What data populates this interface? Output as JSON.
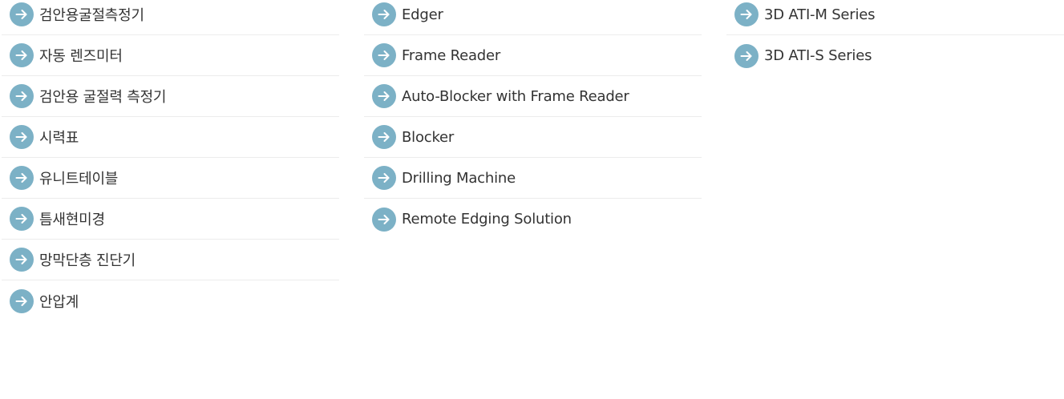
{
  "colors": {
    "icon_background": "#7cb1c6",
    "icon_arrow": "#ffffff",
    "text": "#333333",
    "divider": "#ececec"
  },
  "columns": [
    {
      "items": [
        {
          "label": "검안용굴절측정기",
          "icon": "arrow-right-circle-icon"
        },
        {
          "label": "자동 렌즈미터",
          "icon": "arrow-right-circle-icon"
        },
        {
          "label": "검안용 굴절력 측정기",
          "icon": "arrow-right-circle-icon"
        },
        {
          "label": "시력표",
          "icon": "arrow-right-circle-icon"
        },
        {
          "label": "유니트테이블",
          "icon": "arrow-right-circle-icon"
        },
        {
          "label": "틈새현미경",
          "icon": "arrow-right-circle-icon"
        },
        {
          "label": "망막단층 진단기",
          "icon": "arrow-right-circle-icon"
        },
        {
          "label": "안압계",
          "icon": "arrow-right-circle-icon"
        }
      ]
    },
    {
      "items": [
        {
          "label": "Edger",
          "icon": "arrow-right-circle-icon"
        },
        {
          "label": "Frame Reader",
          "icon": "arrow-right-circle-icon"
        },
        {
          "label": "Auto-Blocker with Frame Reader",
          "icon": "arrow-right-circle-icon"
        },
        {
          "label": "Blocker",
          "icon": "arrow-right-circle-icon"
        },
        {
          "label": "Drilling Machine",
          "icon": "arrow-right-circle-icon"
        },
        {
          "label": "Remote Edging Solution",
          "icon": "arrow-right-circle-icon"
        }
      ]
    },
    {
      "items": [
        {
          "label": "3D ATI-M Series",
          "icon": "arrow-right-circle-icon"
        },
        {
          "label": "3D ATI-S Series",
          "icon": "arrow-right-circle-icon"
        }
      ]
    }
  ]
}
